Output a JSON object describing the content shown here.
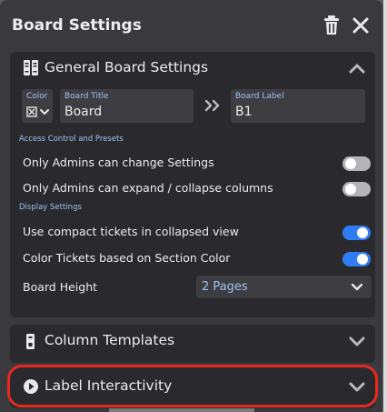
{
  "dialog": {
    "title": "Board Settings",
    "icons": {
      "delete": "trash-icon",
      "close": "close-icon"
    }
  },
  "general": {
    "title": "General Board Settings",
    "icon": "book-icon",
    "color": {
      "label": "Color",
      "icon": "checkbox-x-icon"
    },
    "board_title": {
      "label": "Board Title",
      "value": "Board"
    },
    "board_label": {
      "label": "Board Label",
      "value": "B1"
    },
    "access_group_label": "Access Control and Presets",
    "admins_change_settings": {
      "label": "Only Admins can change Settings",
      "enabled": false
    },
    "admins_expand_columns": {
      "label": "Only Admins can expand / collapse columns",
      "enabled": false
    },
    "display_group_label": "Display Settings",
    "compact_tickets": {
      "label": "Use compact tickets in collapsed view",
      "enabled": true
    },
    "color_tickets": {
      "label": "Color Tickets based on Section Color",
      "enabled": true
    },
    "board_height": {
      "label": "Board Height",
      "value": "2 Pages"
    }
  },
  "column_templates": {
    "title": "Column Templates",
    "icon": "column-icon"
  },
  "label_interactivity": {
    "title": "Label Interactivity",
    "icon": "play-circle-icon"
  },
  "colors": {
    "dialog_bg": "#3a3a3e",
    "section_bg": "#2a2a2e",
    "field_bg": "#3e3e42",
    "label_blue": "#9ec1f2",
    "toggle_on": "#2f7df4",
    "toggle_off": "#b4b4b9",
    "highlight": "#e8281f"
  }
}
